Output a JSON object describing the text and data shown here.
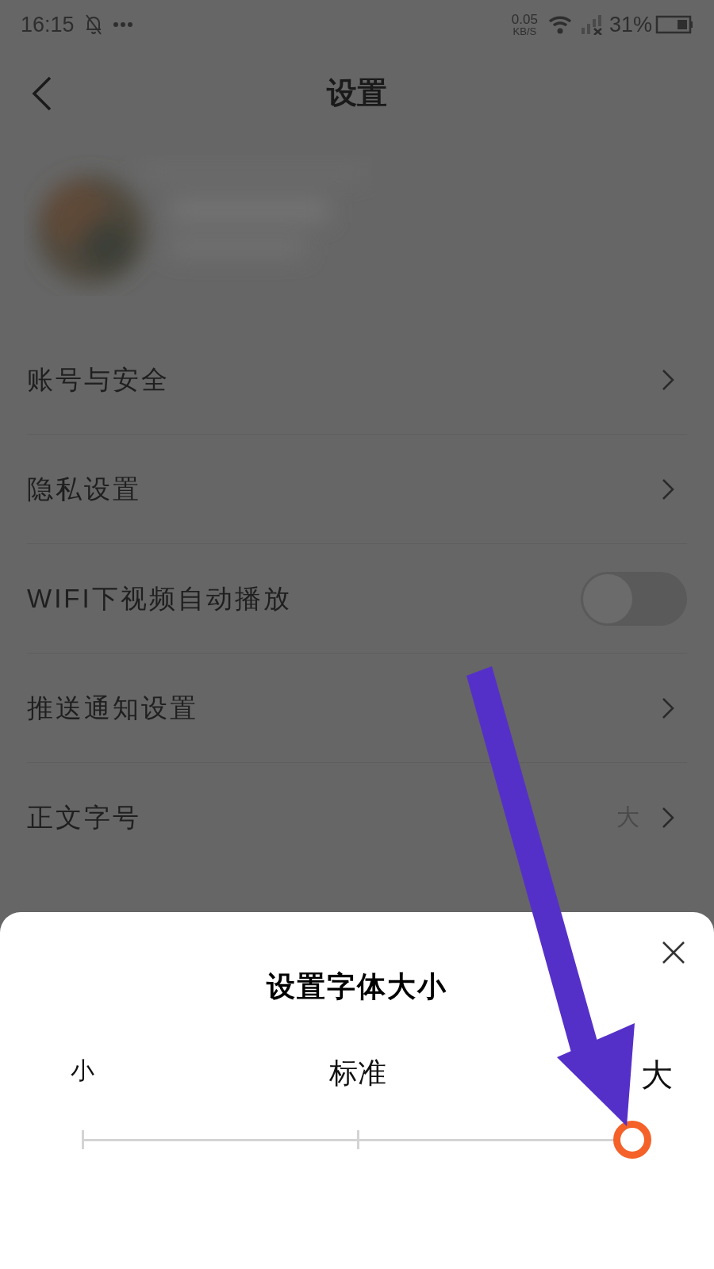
{
  "status_bar": {
    "time": "16:15",
    "speed": "0.05",
    "speed_unit": "KB/S",
    "battery": "31%"
  },
  "header": {
    "title": "设置"
  },
  "settings": [
    {
      "kind": "link",
      "label": "账号与安全"
    },
    {
      "kind": "link",
      "label": "隐私设置"
    },
    {
      "kind": "toggle",
      "label": "WIFI下视频自动播放",
      "on": false
    },
    {
      "kind": "link",
      "label": "推送通知设置"
    },
    {
      "kind": "link",
      "label": "正文字号",
      "value": "大"
    }
  ],
  "sheet": {
    "title": "设置字体大小",
    "options": [
      {
        "label": "小",
        "selected": false
      },
      {
        "label": "标准",
        "selected": false
      },
      {
        "label": "大",
        "selected": true
      }
    ],
    "level": 1
  }
}
